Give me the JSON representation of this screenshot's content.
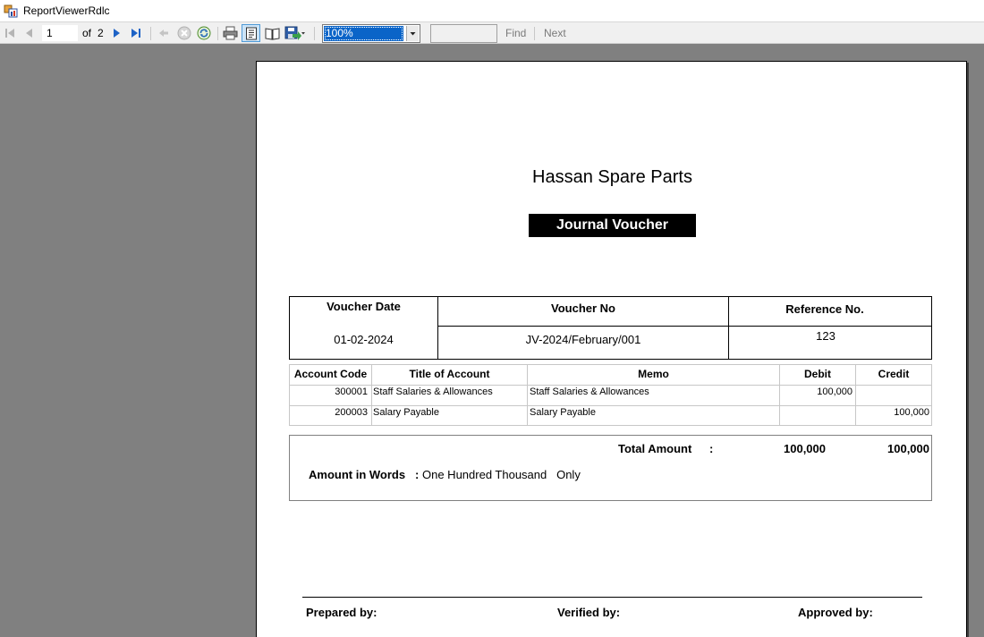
{
  "window": {
    "title": "ReportViewerRdlc"
  },
  "toolbar": {
    "page_current": "1",
    "page_of": "of",
    "page_total": "2",
    "zoom": "100%",
    "find_label": "Find",
    "next_label": "Next",
    "icons": [
      "first-page-icon",
      "previous-page-icon",
      "next-page-icon",
      "last-page-icon",
      "back-icon",
      "stop-icon",
      "refresh-icon",
      "print-icon",
      "print-layout-icon",
      "page-setup-icon",
      "export-icon"
    ]
  },
  "report": {
    "company": "Hassan Spare Parts",
    "title": "Journal Voucher",
    "header": {
      "date_label": "Voucher Date",
      "no_label": "Voucher No",
      "ref_label": "Reference No.",
      "date": "01-02-2024",
      "no": "JV-2024/February/001",
      "ref": "123"
    },
    "columns": [
      "Account Code",
      "Title of Account",
      "Memo",
      "Debit",
      "Credit"
    ],
    "rows": [
      {
        "code": "300001",
        "title": "Staff Salaries & Allowances",
        "memo": "Staff Salaries & Allowances",
        "debit": "100,000",
        "credit": ""
      },
      {
        "code": "200003",
        "title": "Salary Payable",
        "memo": "Salary Payable",
        "debit": "",
        "credit": "100,000"
      }
    ],
    "total_label": "Total Amount",
    "total_colon": ":",
    "total_debit": "100,000",
    "total_credit": "100,000",
    "words_label": "Amount in Words",
    "words_colon": ":",
    "words": "One Hundred Thousand   Only",
    "prepared_by": "Prepared by:",
    "verified_by": "Verified by:",
    "approved_by": "Approved by:"
  }
}
